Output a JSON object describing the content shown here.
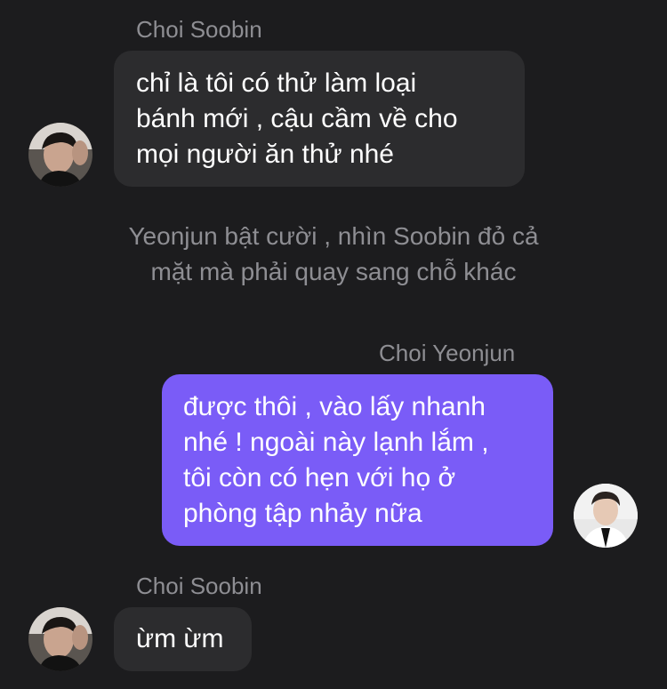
{
  "messages": [
    {
      "sender": "Choi Soobin",
      "lines": [
        "chỉ là tôi có thử làm loại",
        "bánh mới , cậu cầm về cho",
        "mọi người ăn thử nhé"
      ],
      "avatar": "soobin-avatar"
    },
    {
      "narration": [
        "Yeonjun bật cười , nhìn Soobin đỏ cả",
        "mặt mà phải quay sang chỗ khác"
      ]
    },
    {
      "sender": "Choi Yeonjun",
      "lines": [
        "được thôi , vào lấy nhanh",
        "nhé ! ngoài này lạnh lắm ,",
        "tôi còn có hẹn với họ ở",
        "phòng tập nhảy nữa"
      ],
      "avatar": "yeonjun-avatar"
    },
    {
      "sender": "Choi Soobin",
      "lines": [
        "ừm ừm"
      ],
      "avatar": "soobin-avatar"
    }
  ],
  "colors": {
    "background": "#1c1c1e",
    "incoming_bubble": "#2c2c2e",
    "outgoing_bubble": "#7a5cf7",
    "sender_name": "#8e8e93",
    "narration_text": "#8e8e93"
  }
}
